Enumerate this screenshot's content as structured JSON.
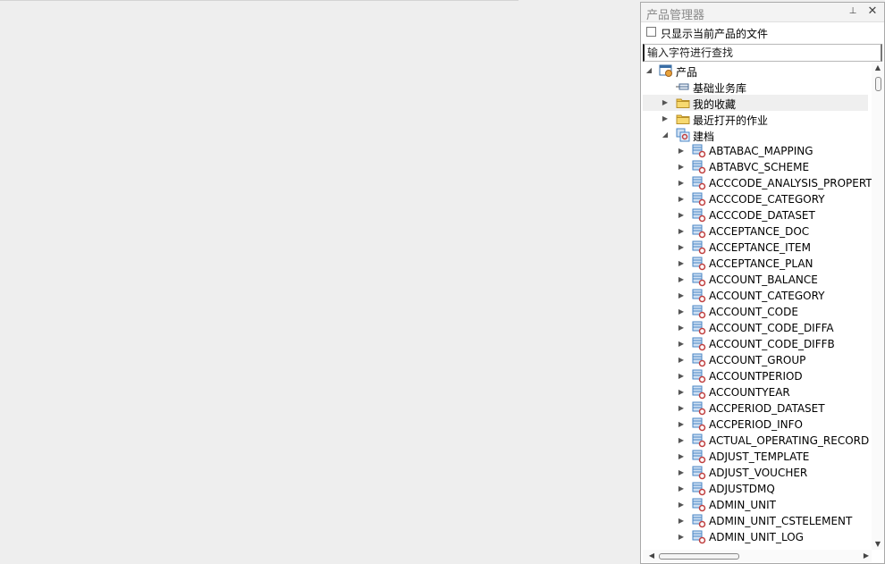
{
  "panel": {
    "title": "产品管理器",
    "pin_glyph": "⊥",
    "close_glyph": "✕",
    "filter_checkbox_label": "只显示当前产品的文件",
    "filter_checked": false,
    "search_placeholder": "输入字符进行查找"
  },
  "tree": {
    "root": {
      "label": "产品",
      "icon": "product-icon",
      "expanded": true
    },
    "children": [
      {
        "label": "基础业务库",
        "icon": "database-icon",
        "expander": "none"
      },
      {
        "label": "我的收藏",
        "icon": "folder-icon",
        "expander": "collapsed"
      },
      {
        "label": "最近打开的作业",
        "icon": "folder-icon",
        "expander": "collapsed"
      },
      {
        "label": "建档",
        "icon": "module-icon",
        "expander": "expanded"
      }
    ],
    "jiandang_items": [
      "ABTABAC_MAPPING",
      "ABTABVC_SCHEME",
      "ACCCODE_ANALYSIS_PROPERTY",
      "ACCCODE_CATEGORY",
      "ACCCODE_DATASET",
      "ACCEPTANCE_DOC",
      "ACCEPTANCE_ITEM",
      "ACCEPTANCE_PLAN",
      "ACCOUNT_BALANCE",
      "ACCOUNT_CATEGORY",
      "ACCOUNT_CODE",
      "ACCOUNT_CODE_DIFFA",
      "ACCOUNT_CODE_DIFFB",
      "ACCOUNT_GROUP",
      "ACCOUNTPERIOD",
      "ACCOUNTYEAR",
      "ACCPERIOD_DATASET",
      "ACCPERIOD_INFO",
      "ACTUAL_OPERATING_RECORD",
      "ADJUST_TEMPLATE",
      "ADJUST_VOUCHER",
      "ADJUSTDMQ",
      "ADMIN_UNIT",
      "ADMIN_UNIT_CSTELEMENT",
      "ADMIN_UNIT_LOG"
    ],
    "item_icon": "entity-icon"
  },
  "colors": {
    "folder": "#f2c94c",
    "entity": "#4a86c5",
    "entity_gear": "#c04040",
    "panel_border": "#a9a9a9"
  }
}
